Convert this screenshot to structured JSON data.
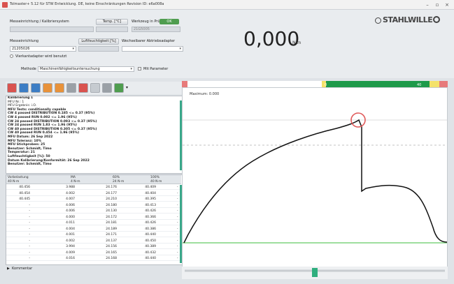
{
  "window": {
    "title": "Tolmaster+ 5.12 für STW Entwicklung. DE, keine Einschränkungen Revision ID: e6a008a",
    "minimize": "–",
    "maximize": "▫",
    "close": "×"
  },
  "header": {
    "messeinrichtung_label": "Messeinrichtung / Kalibriersystem",
    "temp_button": "Temp. [°C]",
    "werkzeug_label": "Werkzeug in Prüfung",
    "toggle_label": "OK",
    "field_2": "21G5005",
    "messeinrichtung2_label": "Messeinrichtung",
    "luftfeuchtigkeit_button": "Luftfeuchtigkeit [%]",
    "wechselbarer_label": "Wechselbarer Abtriebsadapter",
    "messeinrichtung_value": "21205026",
    "verlaengerung_label": "Vierkantadapter wird benutzt",
    "methode_label": "Methode",
    "methode_value": "Maschinenfähigkeitsuntersuchung",
    "mit_parameter_label": "Mit Parameter"
  },
  "logo": "STAHLWILLE",
  "reading": {
    "value": "0,000",
    "unit": "N·m"
  },
  "toolbar": {
    "icons": [
      "print-icon",
      "blue-doc-icon",
      "save-icon",
      "orange-doc-icon",
      "orange-folder-icon",
      "printer-icon",
      "disabled-icon",
      "pencil-icon",
      "green-icon"
    ],
    "colors": {
      "red": "#d9534f",
      "blue": "#3c7dc4",
      "orange": "#e8923a",
      "gray": "#9aa0a6",
      "green": "#4f9d4f"
    }
  },
  "info_panel": {
    "lines": [
      {
        "text": "Kalibrierung 1",
        "bold": true
      },
      {
        "text": "MFU Nr.: 1",
        "bold": false
      },
      {
        "text": "MFU Ergebnis: i.O.",
        "bold": false
      },
      {
        "text": "MFU Tests: conditionally capable",
        "bold": true
      },
      {
        "text": "  CW 4      passed      DISTRIBUTION     0.185 <= 0.37 (95%)",
        "bold": true
      },
      {
        "text": "  CW 4      passed      RUN  0.002 <= 1.96 (95%)",
        "bold": true
      },
      {
        "text": "  CW 24    passed      DISTRIBUTION     0.093 <= 0.37 (95%)",
        "bold": true
      },
      {
        "text": "  CW 24    passed      RUN  1.83 <= 1.96 (95%)",
        "bold": true
      },
      {
        "text": "  CW 40    passed      DISTRIBUTION     0.305 <= 0.37 (95%)",
        "bold": true
      },
      {
        "text": "  CW 40    passed      RUN  0.454 <= 1.96 (95%)",
        "bold": true
      },
      {
        "text": "MFU Datum: 26 Sep 2022",
        "bold": true
      },
      {
        "text": "MFU Toleranz: 10%",
        "bold": true
      },
      {
        "text": "MFU Stichproben: 25",
        "bold": true
      },
      {
        "text": "Benutzer: Schmidt, Timo",
        "bold": true
      },
      {
        "text": "Temperatur: 21",
        "bold": true
      },
      {
        "text": "Luftfeuchtigkeit [%]: 50",
        "bold": true
      },
      {
        "text": "Datum Kalibrierung/Konformität: 26 Sep 2022",
        "bold": true
      },
      {
        "text": "Benutzer: Schmidt, Timo",
        "bold": true
      }
    ]
  },
  "table": {
    "headers": [
      {
        "top": "Vorbelastung",
        "bottom": "40 N·m"
      },
      {
        "top": "MA",
        "bottom": "4 N·m"
      },
      {
        "top": "60%",
        "bottom": "24 N·m"
      },
      {
        "top": "100%",
        "bottom": "40 N·m"
      }
    ],
    "rows": [
      [
        "40.456",
        "3.988",
        "24.176",
        "40.409"
      ],
      [
        "40.454",
        "4.002",
        "24.177",
        "40.404"
      ],
      [
        "40.445",
        "4.007",
        "24.210",
        "40.395"
      ],
      [
        "-",
        "4.006",
        "24.180",
        "40.413"
      ],
      [
        "-",
        "4.006",
        "24.130",
        "40.426"
      ],
      [
        "-",
        "4.000",
        "24.172",
        "40.366"
      ],
      [
        "-",
        "4.011",
        "24.181",
        "40.426"
      ],
      [
        "-",
        "4.004",
        "24.189",
        "40.386"
      ],
      [
        "-",
        "4.001",
        "24.171",
        "40.440"
      ],
      [
        "-",
        "4.002",
        "24.137",
        "40.450"
      ],
      [
        "-",
        "3.994",
        "24.156",
        "40.389"
      ],
      [
        "-",
        "4.009",
        "24.165",
        "40.432"
      ],
      [
        "-",
        "4.016",
        "24.168",
        "40.440"
      ]
    ]
  },
  "comment_bar": {
    "arrow": "▶",
    "label": "Kommentar"
  },
  "chart_data": {
    "type": "line",
    "title": "Maximum: 0.000",
    "tolerance_labels": [
      "0",
      "40"
    ],
    "note": "torque curve rising to peak, sharp drop, then plateau; peak marked with red circle"
  },
  "colors": {
    "accent_green": "#3aa88a",
    "peak_marker": "#e05a5a",
    "baseline": "#7fd37f"
  }
}
